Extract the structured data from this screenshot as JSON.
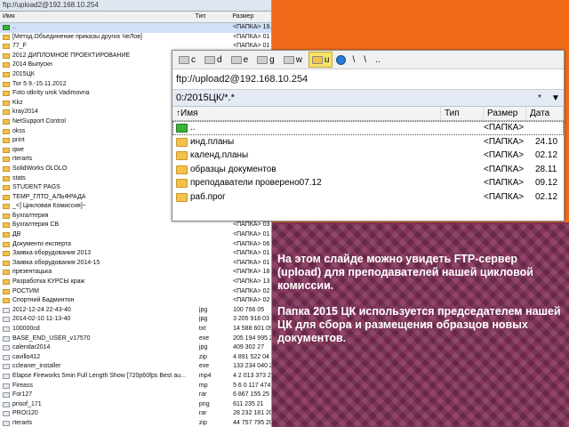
{
  "back_window": {
    "path": "ftp://upload2@192.168.10.254",
    "headers": {
      "name": "Имя",
      "type": "Тип",
      "size": "Размер"
    },
    "rows": [
      {
        "name": "..",
        "type": "",
        "size": "<ПАПКА> 19.5",
        "kind": "up"
      },
      {
        "name": "[Метод.Объединение приказы других ЧеЛов]",
        "type": "",
        "size": "<ПАПКА> 01",
        "kind": "dir"
      },
      {
        "name": "77_F",
        "type": "",
        "size": "<ПАПКА> 01",
        "kind": "dir"
      },
      {
        "name": "2012 ДИПЛОМНОЕ ПРОЕКТИРОВАНИЕ",
        "type": "",
        "size": "<ПАПКА> 07",
        "kind": "dir"
      },
      {
        "name": "2014 Выпускн",
        "type": "",
        "size": "<ПАПКА> 01",
        "kind": "dir"
      },
      {
        "name": "2015ЦК",
        "type": "",
        "size": "<ПАПКА> 09",
        "kind": "dir"
      },
      {
        "name": "Тог 5 9.-15.11.2012",
        "type": "",
        "size": "<ПАПКА> 05",
        "kind": "dir"
      },
      {
        "name": "Foto otkrity urok Vadimovna",
        "type": "",
        "size": "<ПАПКА> 04",
        "kind": "dir"
      },
      {
        "name": "Kkz",
        "type": "",
        "size": "<ПАПКА> 01",
        "kind": "dir"
      },
      {
        "name": "kray2014",
        "type": "",
        "size": "<ПАПКА> 01",
        "kind": "dir"
      },
      {
        "name": "NetSupport Control",
        "type": "",
        "size": "<ПАПКА> 01",
        "kind": "dir"
      },
      {
        "name": "okss",
        "type": "",
        "size": "<ПАПКА> 01",
        "kind": "dir"
      },
      {
        "name": "print",
        "type": "",
        "size": "<ПАПКА> 01",
        "kind": "dir"
      },
      {
        "name": "qwe",
        "type": "",
        "size": "<ПАПКА> 01",
        "kind": "dir"
      },
      {
        "name": "rterarts",
        "type": "",
        "size": "<ПАПКА> 01",
        "kind": "dir"
      },
      {
        "name": "SolidWorks OLOLO",
        "type": "",
        "size": "<ПАПКА> 01",
        "kind": "dir"
      },
      {
        "name": "stats",
        "type": "",
        "size": "<ПАПКА> 01",
        "kind": "dir"
      },
      {
        "name": "STUDENT PAGS",
        "type": "",
        "size": "<ПАПКА> 01",
        "kind": "dir"
      },
      {
        "name": "ТЕМР_ГЛТО_АЛЬФРАДА",
        "type": "",
        "size": "<ПАПКА> 01",
        "kind": "dir"
      },
      {
        "name": "_<] Цикловая Комиссия]~",
        "type": "",
        "size": "<ПАПКА> 01",
        "kind": "dir"
      },
      {
        "name": "Бухгалтерия",
        "type": "",
        "size": "<ПАПКА> 01",
        "kind": "dir"
      },
      {
        "name": "Бухгалтерия СВ",
        "type": "",
        "size": "<ПАПКА> 03",
        "kind": "dir"
      },
      {
        "name": "ДВ",
        "type": "",
        "size": "<ПАПКА> 01",
        "kind": "dir"
      },
      {
        "name": "Документи експерта",
        "type": "",
        "size": "<ПАПКА> 06",
        "kind": "dir"
      },
      {
        "name": "Заявка оборудования 2013",
        "type": "",
        "size": "<ПАПКА> 01",
        "kind": "dir"
      },
      {
        "name": "Заявка оборудования 2014-15",
        "type": "",
        "size": "<ПАПКА> 01",
        "kind": "dir"
      },
      {
        "name": "презентацька",
        "type": "",
        "size": "<ПАПКА> 18",
        "kind": "dir"
      },
      {
        "name": "Разработка КУРСЫ краж",
        "type": "",
        "size": "<ПАПКА> 13",
        "kind": "dir"
      },
      {
        "name": "РОСТИМ",
        "type": "",
        "size": "<ПАПКА> 02",
        "kind": "dir"
      },
      {
        "name": "Спортний Бадминтон",
        "type": "",
        "size": "<ПАПКА> 02",
        "kind": "dir"
      },
      {
        "name": "2012-12-24 22-43-40",
        "type": "jpg",
        "size": "100 766 05",
        "kind": "file"
      },
      {
        "name": "2014-02-10 11-13-40",
        "type": "jpg",
        "size": "3 205 918 03",
        "kind": "file"
      },
      {
        "name": "100000cd",
        "type": "txt",
        "size": "14 588 601 09",
        "kind": "file"
      },
      {
        "name": "BASE_END_USER_v17570",
        "type": "exe",
        "size": "205 194 995 26",
        "kind": "file"
      },
      {
        "name": "calendar2014",
        "type": "jpg",
        "size": "409 302 27",
        "kind": "file"
      },
      {
        "name": "cavillo412",
        "type": "zip",
        "size": "4 891 522 04",
        "kind": "file"
      },
      {
        "name": "ccleaner_installer",
        "type": "exe",
        "size": "133 234 040 29",
        "kind": "file"
      },
      {
        "name": "Elapse Fireworks 5min Full Length Show [720p60fps Best au...",
        "type": "mp4",
        "size": "4 2 013 373 22",
        "kind": "file"
      },
      {
        "name": "Fireass",
        "type": "mp",
        "size": "5 6 0 117 474 25",
        "kind": "file"
      },
      {
        "name": "For127",
        "type": "rar",
        "size": "6 867 155 25",
        "kind": "file"
      },
      {
        "name": "prisof_171",
        "type": "png",
        "size": "611 235 21",
        "kind": "file"
      },
      {
        "name": "PROI120",
        "type": "rar",
        "size": "28 232 181 20",
        "kind": "file"
      },
      {
        "name": "rterarts",
        "type": "zip",
        "size": "44 757 795 20",
        "kind": "file"
      },
      {
        "name": "sgs-setup-4.0.1_all_0.6.2",
        "type": "iso",
        "size": "570 966 015 18",
        "kind": "file"
      },
      {
        "name": "StylesExplorer Setup 550",
        "type": "exe",
        "size": "2 292 792 13",
        "kind": "file"
      }
    ]
  },
  "front_window": {
    "drives": [
      {
        "letter": "c",
        "active": false
      },
      {
        "letter": "d",
        "active": false
      },
      {
        "letter": "e",
        "active": false
      },
      {
        "letter": "g",
        "active": false
      },
      {
        "letter": "w",
        "active": false
      },
      {
        "letter": "u",
        "active": true
      }
    ],
    "nav_extra": [
      "\\",
      "\\",
      ".."
    ],
    "address": "ftp://upload2@192.168.10.254",
    "path": "0:/2015ЦК/*.*",
    "path_buttons": [
      "*",
      "▼"
    ],
    "headers": {
      "name": "↑Имя",
      "type": "Тип",
      "size": "Размер",
      "date": "Дата"
    },
    "rows": [
      {
        "name": "..",
        "type": "",
        "size": "<ПАПКА>",
        "date": "",
        "kind": "up"
      },
      {
        "name": "инд.планы",
        "type": "",
        "size": "<ПАПКА>",
        "date": "24.10",
        "kind": "dir"
      },
      {
        "name": "календ.планы",
        "type": "",
        "size": "<ПАПКА>",
        "date": "02.12",
        "kind": "dir"
      },
      {
        "name": "образцы документов",
        "type": "",
        "size": "<ПАПКА>",
        "date": "28.11",
        "kind": "dir"
      },
      {
        "name": "преподаватели проверено07.12",
        "type": "",
        "size": "<ПАПКА>",
        "date": "09.12",
        "kind": "dir"
      },
      {
        "name": "раб.прог",
        "type": "",
        "size": "<ПАПКА>",
        "date": "02.12",
        "kind": "dir"
      }
    ]
  },
  "caption": {
    "p1": "На этом слайде можно увидеть FTP-сервер (upload) для преподавателей нашей цикловой комиссии.",
    "p2": " Папка 2015 ЦК используется председателем нашей ЦК для сбора и размещения образцов новых документов."
  }
}
